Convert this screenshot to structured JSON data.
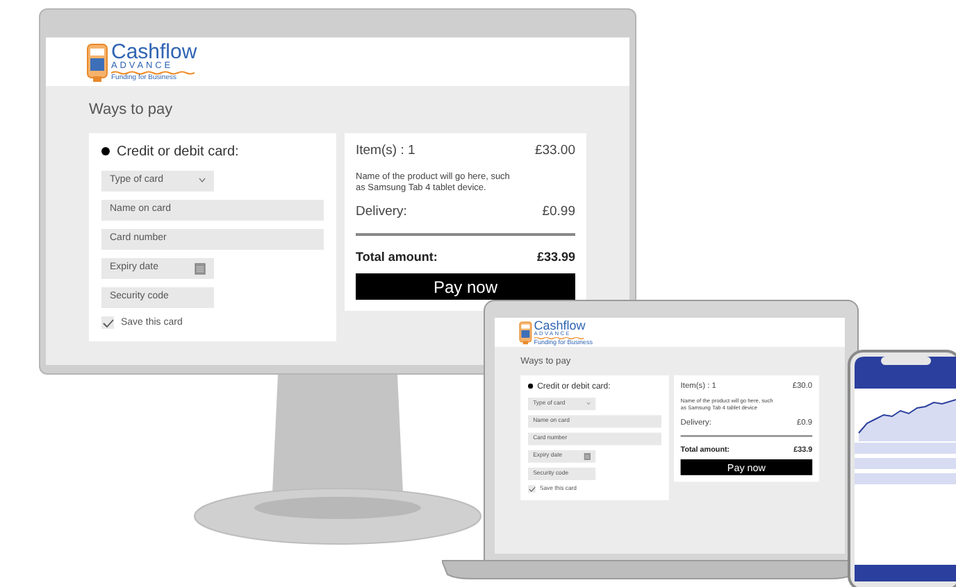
{
  "monitor": {
    "logo": {
      "name": "Cashflow",
      "tagline": "ADVANCE",
      "subtitle": "Funding for Business"
    },
    "heading": "Ways to pay",
    "payment_option": {
      "label": "Credit or debit card:",
      "selected": true
    },
    "fields": [
      {
        "kind": "select",
        "placeholder": "Type of card"
      },
      {
        "kind": "text",
        "placeholder": "Name on card"
      },
      {
        "kind": "text",
        "placeholder": "Card number"
      },
      {
        "kind": "date",
        "placeholder": "Expiry date"
      },
      {
        "kind": "code",
        "placeholder": "Security code"
      }
    ],
    "save_card": {
      "label": "Save this card",
      "checked": true
    },
    "summary": {
      "items_label": "Item(s) : 1",
      "items_price": "£33.00",
      "description": "Name of the product will go here, such as Samsung Tab 4 tablet device.",
      "delivery_label": "Delivery:",
      "delivery_price": "£0.99",
      "total_label": "Total amount:",
      "total_price": "£33.99"
    },
    "pay_button": "Pay now"
  },
  "laptop": {
    "logo": {
      "name": "Cashflow",
      "tagline": "ADVANCE",
      "subtitle": "Funding for Business"
    },
    "heading": "Ways to pay",
    "payment_option": {
      "label": "Credit or debit card:",
      "selected": true
    },
    "fields": [
      {
        "kind": "select",
        "placeholder": "Type of card"
      },
      {
        "kind": "text",
        "placeholder": "Name on card"
      },
      {
        "kind": "text",
        "placeholder": "Card number"
      },
      {
        "kind": "date",
        "placeholder": "Expiry date"
      },
      {
        "kind": "code",
        "placeholder": "Security code"
      }
    ],
    "save_card": {
      "label": "Save this card",
      "checked": true
    },
    "summary": {
      "items_label": "Item(s) : 1",
      "items_price": "£30.0",
      "description": "Name of the product will go here, such as Samsung Tab 4 tablet device",
      "delivery_label": "Delivery:",
      "delivery_price": "£0.9",
      "total_label": "Total amount:",
      "total_price": "£33.9"
    },
    "pay_button": "Pay now"
  }
}
